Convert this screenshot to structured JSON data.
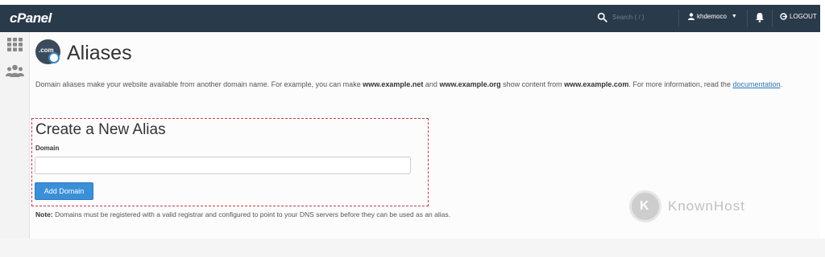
{
  "topbar": {
    "logo": "cPanel",
    "search_placeholder": "Search ( / )",
    "username": "khdemoco",
    "logout_label": "LOGOUT"
  },
  "sidebar": {
    "icons": [
      "apps-grid-icon",
      "users-icon"
    ]
  },
  "page": {
    "title": "Aliases",
    "title_icon_text": ".com",
    "description": {
      "text1": "Domain aliases make your website available from another domain name. For example, you can make ",
      "example_net": "www.example.net",
      "text2": " and ",
      "example_org": "www.example.org",
      "text3": " show content from ",
      "example_com": "www.example.com",
      "text4": ". For more information, read the ",
      "link": "documentation",
      "text5": "."
    }
  },
  "form": {
    "section_title": "Create a New Alias",
    "domain_label": "Domain",
    "domain_value": "",
    "add_button": "Add Domain",
    "note_label": "Note:",
    "note_text": " Domains must be registered with a valid registrar and configured to point to your DNS servers before they can be used as an alias."
  },
  "watermark": {
    "text": "KnownHost"
  },
  "colors": {
    "topbar": "#293a4a",
    "accent_button": "#3a8fd9",
    "link": "#2f78b7",
    "highlight_border": "#c23c4a"
  }
}
